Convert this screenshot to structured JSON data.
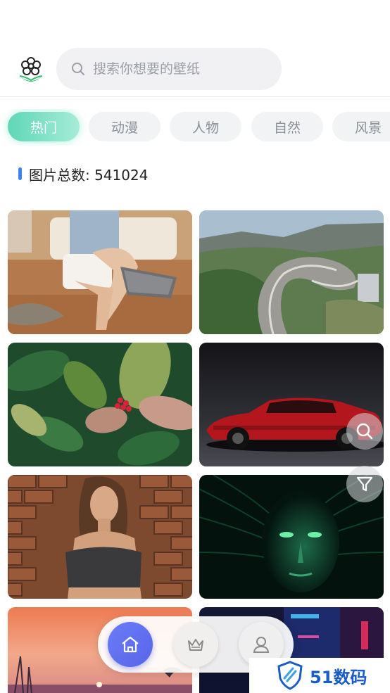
{
  "search": {
    "placeholder": "搜索你想要的壁纸"
  },
  "tabs": [
    {
      "label": "热门",
      "active": true
    },
    {
      "label": "动漫",
      "active": false
    },
    {
      "label": "人物",
      "active": false
    },
    {
      "label": "自然",
      "active": false
    },
    {
      "label": "风景",
      "active": false
    }
  ],
  "stats": {
    "label": "图片总数: 541024"
  },
  "wallpapers": [
    {
      "subject": "woman sitting on sofa"
    },
    {
      "subject": "mountain highway interchange"
    },
    {
      "subject": "green leaves with red berries"
    },
    {
      "subject": "red sports car"
    },
    {
      "subject": "woman by brick wall"
    },
    {
      "subject": "green digital face"
    },
    {
      "subject": "sunset over sea"
    },
    {
      "subject": "neon city"
    }
  ],
  "fabs": {
    "search_icon": "search-icon",
    "filter_icon": "filter-icon"
  },
  "bottom_nav": [
    {
      "icon": "home-icon",
      "active": true
    },
    {
      "icon": "crown-icon",
      "active": false
    },
    {
      "icon": "user-icon",
      "active": false
    }
  ],
  "watermark": {
    "text": "51数码"
  },
  "colors": {
    "accent": "#5865e8",
    "tab_active": "#5fd7b7",
    "count_bar": "#3b82f6"
  }
}
